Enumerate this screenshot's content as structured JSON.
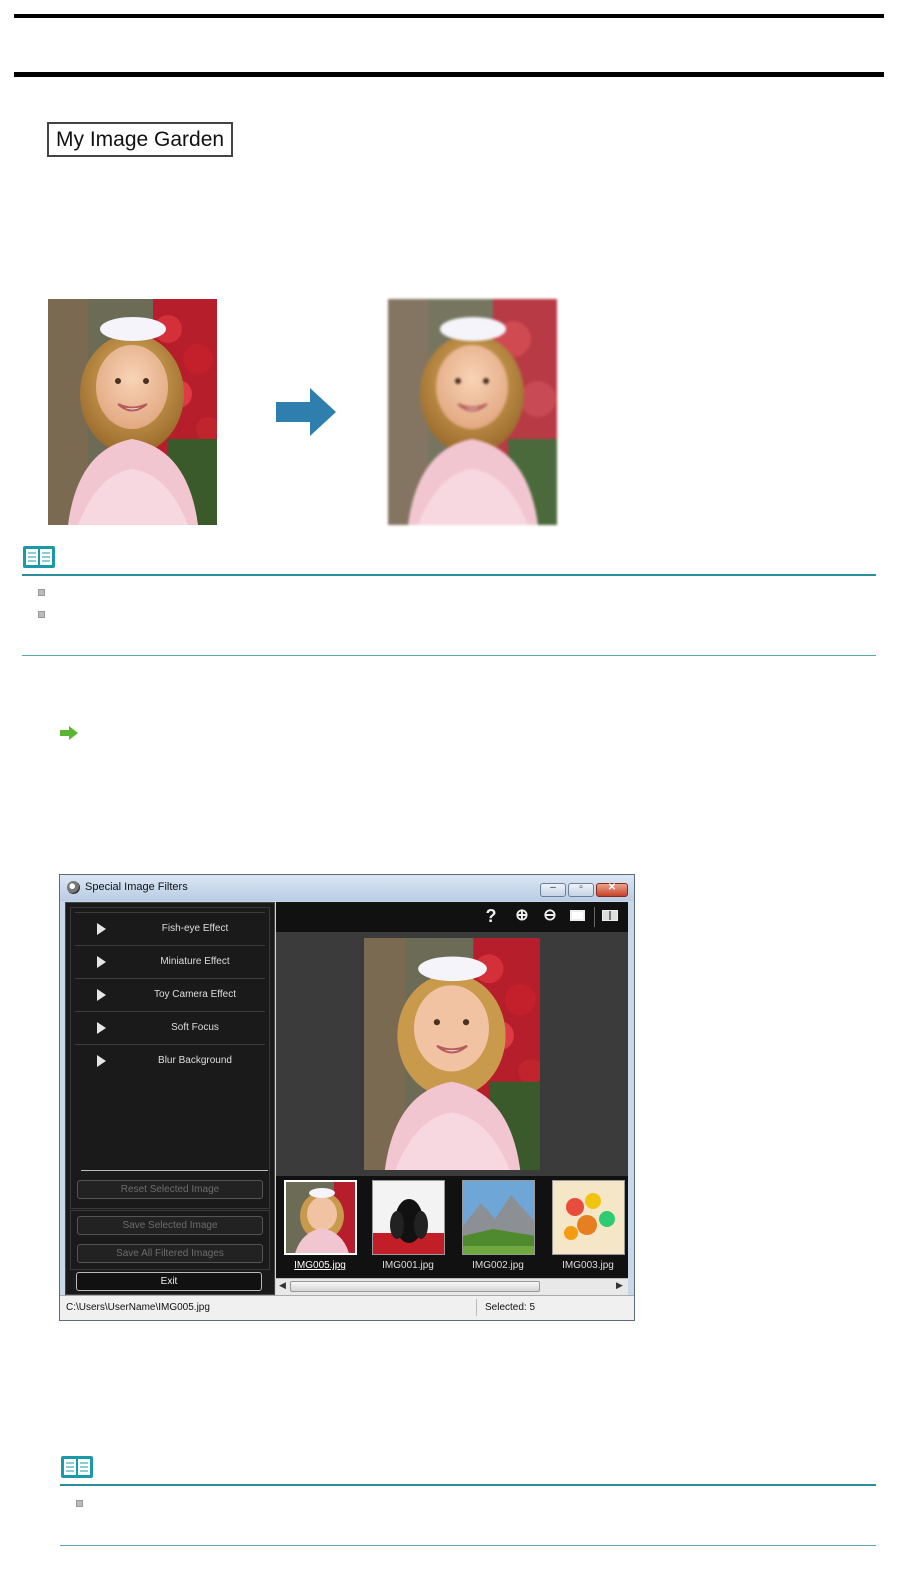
{
  "page": {
    "badge_label": "My Image Garden"
  },
  "window": {
    "title": "Special Image Filters",
    "min_icon": "minimize-icon",
    "max_icon": "maximize-icon",
    "close_icon": "close-icon",
    "effects": [
      "Fish-eye Effect",
      "Miniature Effect",
      "Toy Camera Effect",
      "Soft Focus",
      "Blur Background"
    ],
    "buttons": {
      "reset": "Reset Selected Image",
      "save_selected": "Save Selected Image",
      "save_all": "Save All Filtered Images",
      "exit": "Exit"
    },
    "toolbar_icons": [
      "help-icon",
      "zoom-in-icon",
      "zoom-out-icon",
      "full-screen-icon",
      "compare-icon"
    ],
    "thumbnails": [
      {
        "label": "IMG005.jpg",
        "selected": true
      },
      {
        "label": "IMG001.jpg",
        "selected": false
      },
      {
        "label": "IMG002.jpg",
        "selected": false
      },
      {
        "label": "IMG003.jpg",
        "selected": false
      }
    ],
    "status": {
      "path": "C:\\Users\\UserName\\IMG005.jpg",
      "selected": "Selected: 5"
    }
  },
  "colors": {
    "rule_teal": "#2a8f9c",
    "note_icon_teal": "#1a9aa8",
    "arrow_blue": "#2e7fae",
    "link_arrow_green": "#5bb534"
  }
}
